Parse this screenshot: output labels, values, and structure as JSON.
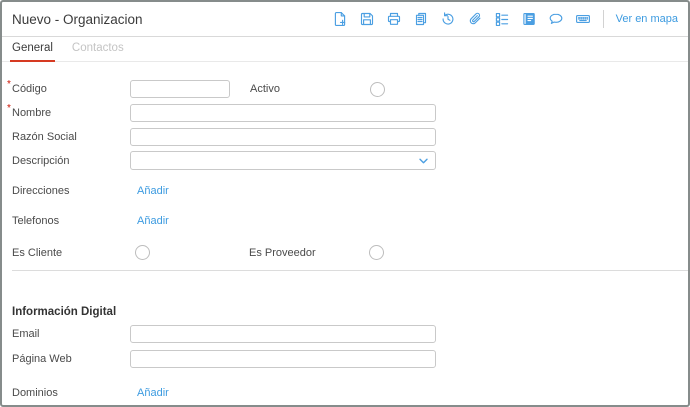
{
  "header": {
    "title": "Nuevo - Organizacion"
  },
  "toolbar": {
    "icons": [
      "new-document",
      "save",
      "print",
      "copy",
      "history",
      "attachment",
      "checklist",
      "journal",
      "comment",
      "keyboard"
    ],
    "map_link_label": "Ver en mapa"
  },
  "tabs": [
    {
      "label": "General",
      "active": true
    },
    {
      "label": "Contactos",
      "active": false
    }
  ],
  "form": {
    "required_marker": "*",
    "fields": {
      "codigo": {
        "label": "Código",
        "required": true,
        "value": "",
        "type": "text"
      },
      "activo": {
        "label": "Activo",
        "checked": false,
        "type": "radio"
      },
      "nombre": {
        "label": "Nombre",
        "required": true,
        "value": "",
        "type": "text"
      },
      "razon_social": {
        "label": "Razón Social",
        "value": "",
        "type": "text"
      },
      "descripcion": {
        "label": "Descripción",
        "value": "",
        "type": "select"
      },
      "direcciones": {
        "label": "Direcciones",
        "action": "Añadir"
      },
      "telefonos": {
        "label": "Telefonos",
        "action": "Añadir"
      },
      "es_cliente": {
        "label": "Es Cliente",
        "checked": false,
        "type": "radio"
      },
      "es_proveedor": {
        "label": "Es Proveedor",
        "checked": false,
        "type": "radio"
      }
    },
    "digital_section": {
      "title": "Información Digital",
      "fields": {
        "email": {
          "label": "Email",
          "value": "",
          "type": "text"
        },
        "pagina_web": {
          "label": "Página Web",
          "value": "",
          "type": "text"
        },
        "dominios": {
          "label": "Dominios",
          "action": "Añadir"
        }
      }
    }
  },
  "colors": {
    "icon_blue": "#4b9fe2",
    "link_blue": "#3d9be0",
    "active_tab_red": "#d63a22",
    "required_red": "#cc1100"
  }
}
